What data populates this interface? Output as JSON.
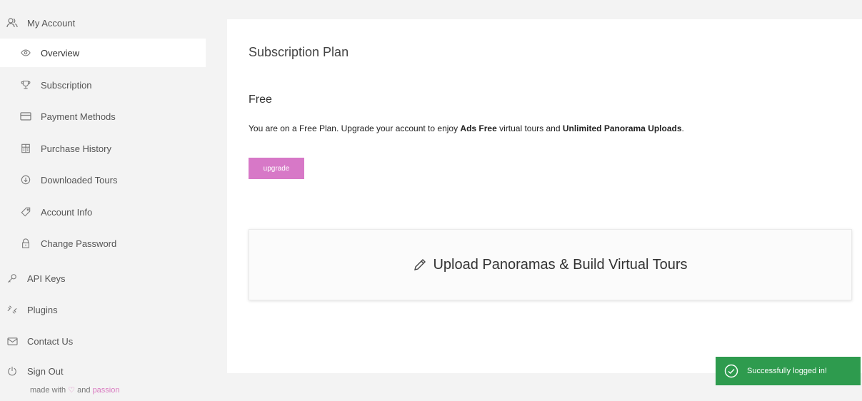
{
  "sidebar": {
    "account_label": "My Account",
    "items": [
      {
        "label": "Overview",
        "icon": "eye-icon"
      },
      {
        "label": "Subscription",
        "icon": "trophy-icon"
      },
      {
        "label": "Payment Methods",
        "icon": "credit-card-icon"
      },
      {
        "label": "Purchase History",
        "icon": "receipt-icon"
      },
      {
        "label": "Downloaded Tours",
        "icon": "download-icon"
      },
      {
        "label": "Account Info",
        "icon": "tag-icon"
      },
      {
        "label": "Change Password",
        "icon": "lock-icon"
      }
    ],
    "api_keys_label": "API Keys",
    "plugins_label": "Plugins",
    "contact_label": "Contact Us",
    "signout_label": "Sign Out",
    "made_with_prefix": "made with",
    "made_with_and": "and",
    "made_with_passion": "passion"
  },
  "main": {
    "section_title": "Subscription Plan",
    "plan_name": "Free",
    "desc_part1": "You are on a Free Plan. Upgrade your account to enjoy ",
    "desc_bold1": "Ads Free",
    "desc_part2": " virtual tours and ",
    "desc_bold2": "Unlimited Panorama Uploads",
    "desc_part3": ".",
    "upgrade_label": "upgrade",
    "upload_label": "Upload Panoramas & Build Virtual Tours"
  },
  "toast": {
    "message": "Successfully logged in!"
  },
  "colors": {
    "accent": "#d778c7",
    "success": "#2e9b4e",
    "background": "#f3f3f3"
  }
}
